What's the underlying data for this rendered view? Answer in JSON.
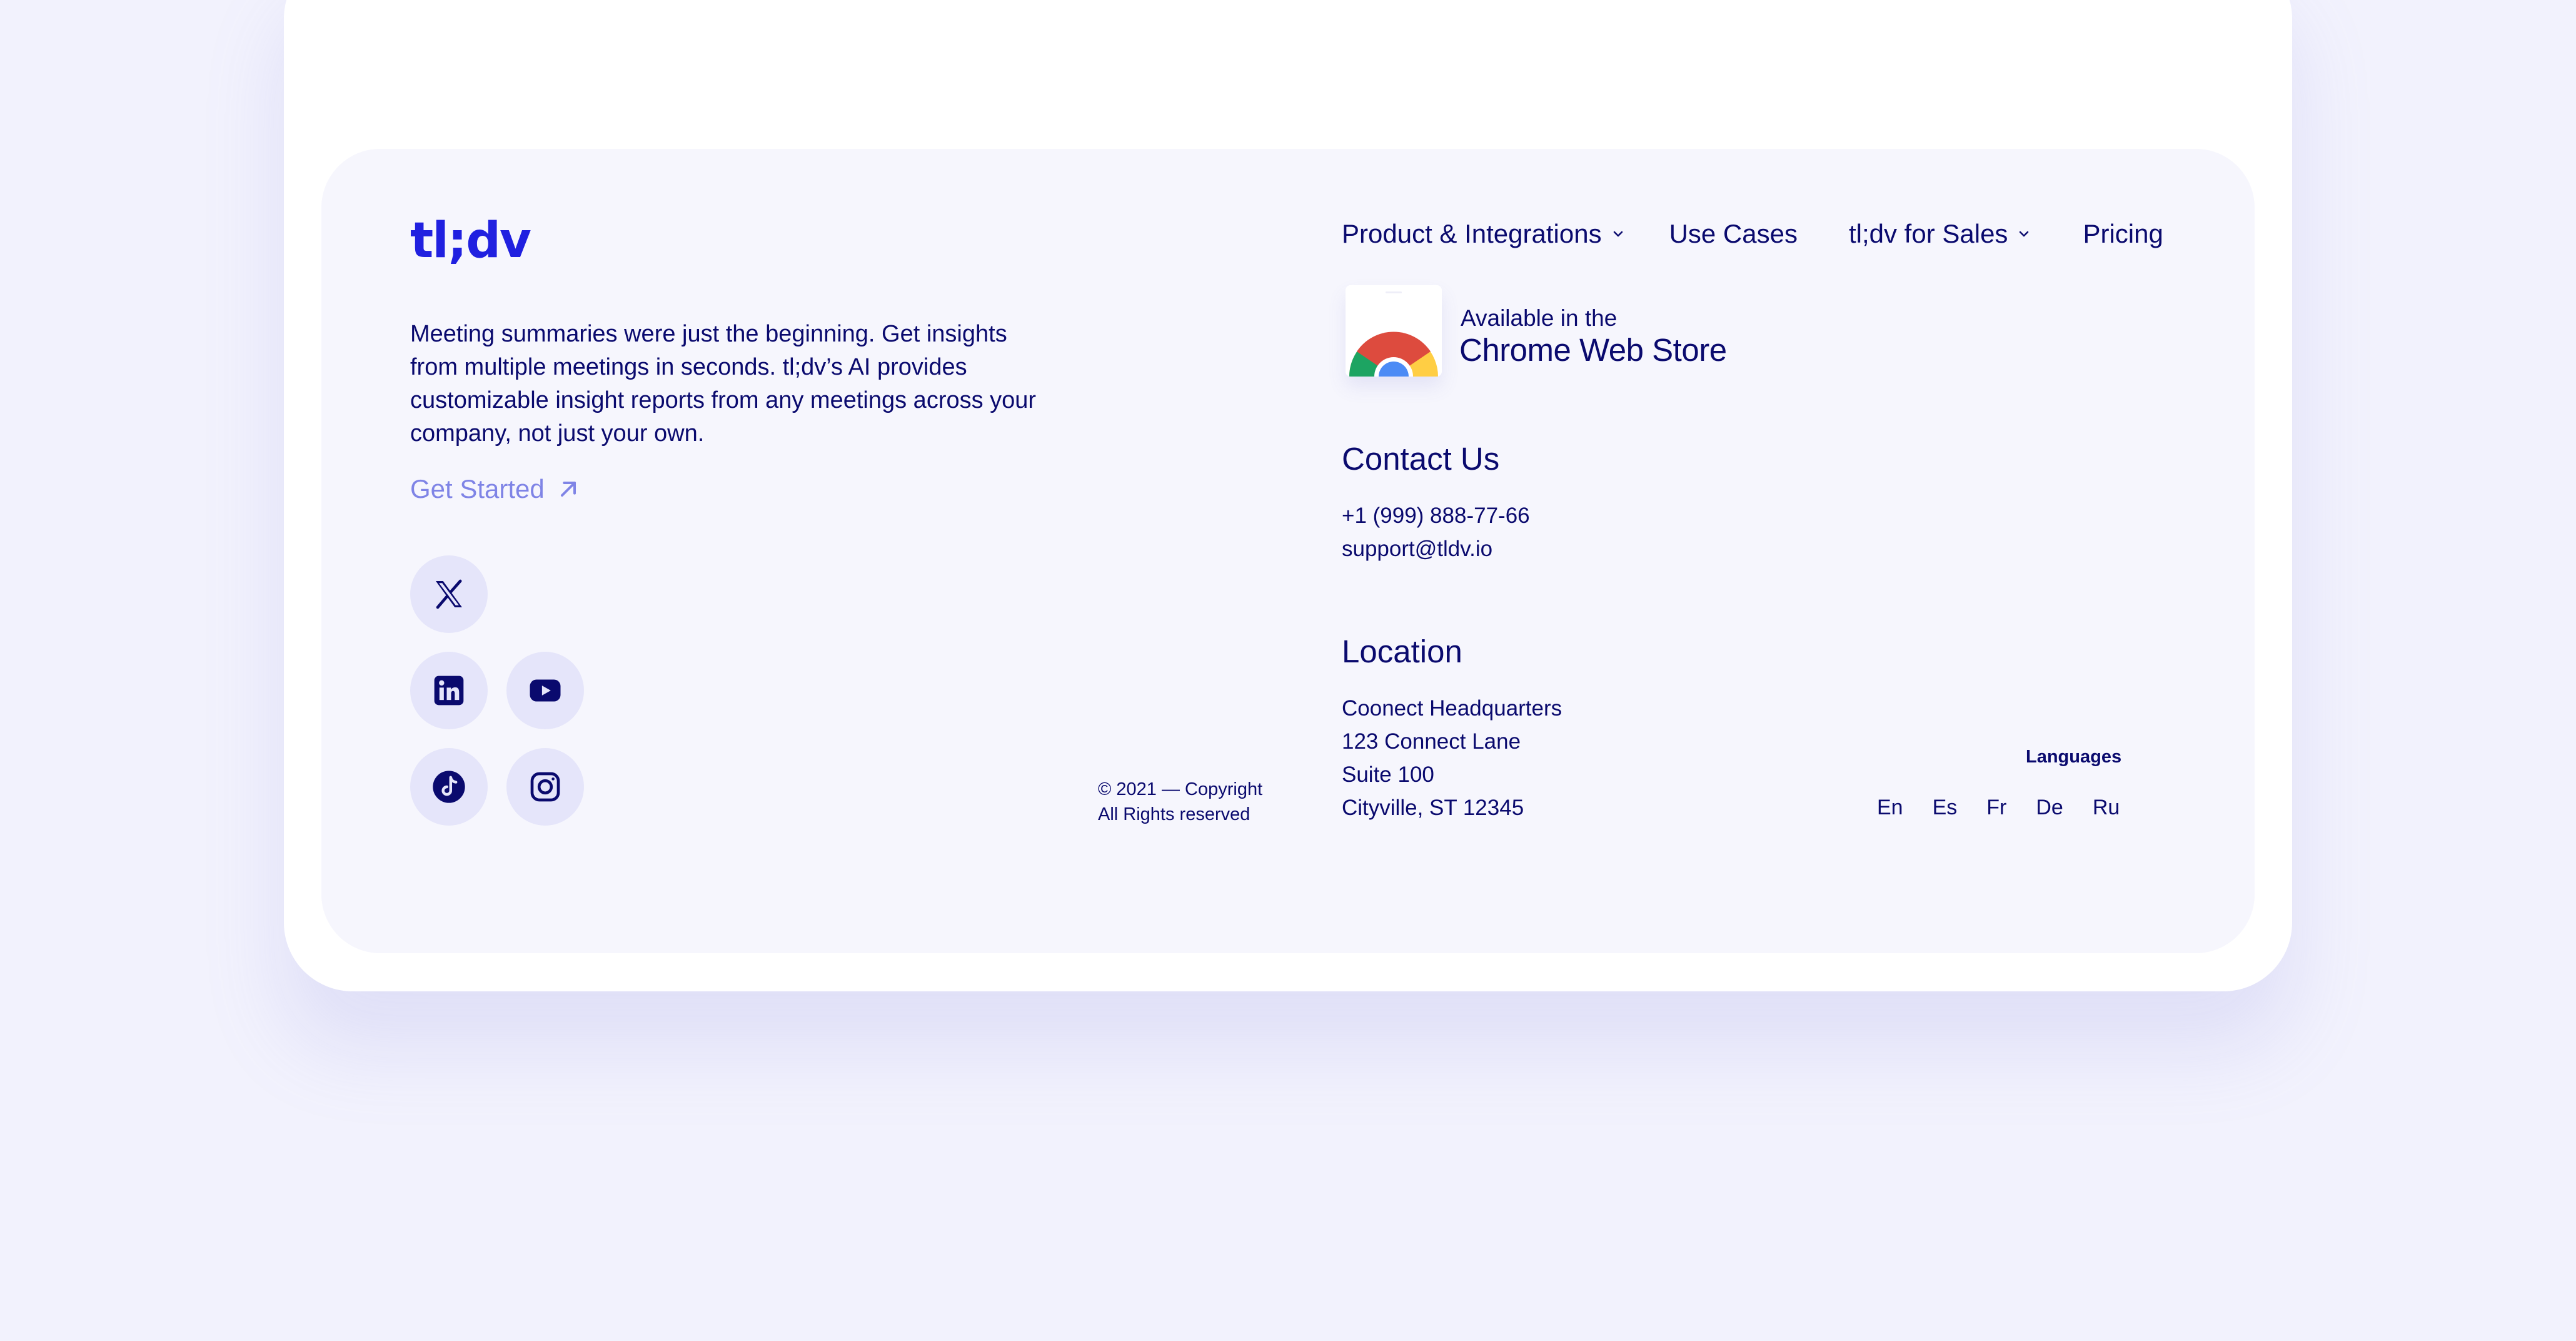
{
  "brand": {
    "logo": "tl;dv",
    "accent_color": "#2020e0",
    "text_color": "#0a0a6e"
  },
  "description": "Meeting summaries were just the beginning. Get insights from multiple meetings in seconds. tl;dv’s AI provides customizable insight reports from any meetings across your company, not just your own.",
  "cta": {
    "label": "Get Started",
    "icon": "arrow-up-right-icon"
  },
  "social": [
    {
      "icon": "x-twitter-icon"
    },
    {
      "icon": "linkedin-icon"
    },
    {
      "icon": "youtube-icon"
    },
    {
      "icon": "tiktok-icon"
    },
    {
      "icon": "instagram-icon"
    }
  ],
  "copyright": {
    "line1": "© 2021 — Copyright",
    "line2": "All Rights reserved"
  },
  "nav": {
    "items": [
      {
        "label": "Product & Integrations",
        "has_dropdown": true
      },
      {
        "label": "Use Cases",
        "has_dropdown": false
      },
      {
        "label": "tl;dv for Sales",
        "has_dropdown": true
      },
      {
        "label": "Pricing",
        "has_dropdown": false
      }
    ]
  },
  "chrome_store": {
    "small_text": "Available in the",
    "big_text": "Chrome Web Store",
    "icon": "chrome-icon"
  },
  "contact": {
    "heading": "Contact Us",
    "phone": "+1 (999) 888-77-66",
    "email": "support@tldv.io"
  },
  "location": {
    "heading": "Location",
    "lines": [
      "Coonect Headquarters",
      "123 Connect Lane",
      "Suite 100",
      "Cityville, ST 12345"
    ]
  },
  "languages": {
    "label": "Languages",
    "items": [
      "En",
      "Es",
      "Fr",
      "De",
      "Ru"
    ]
  }
}
